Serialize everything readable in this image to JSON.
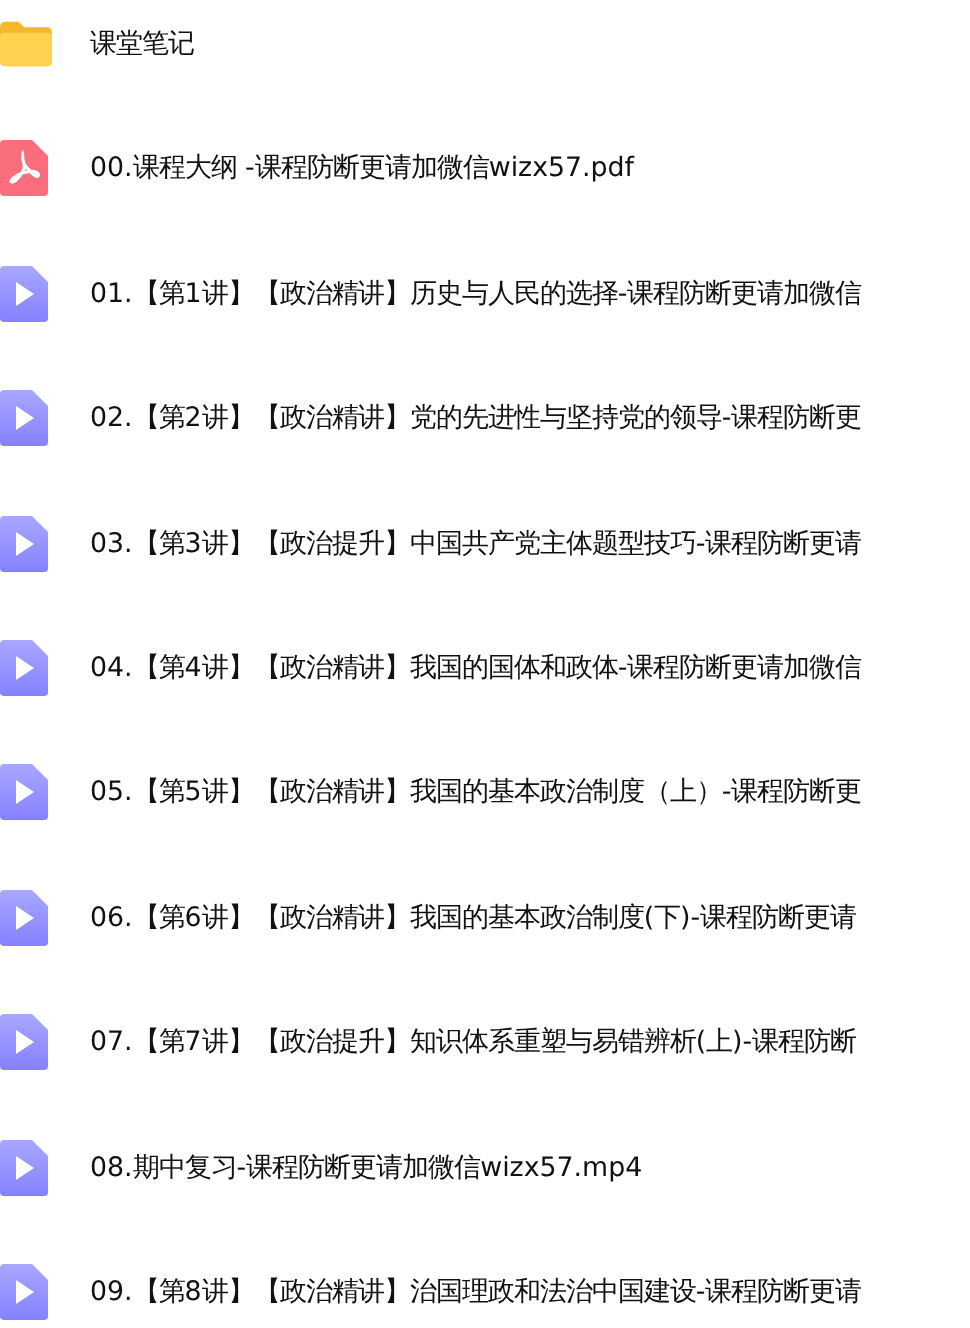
{
  "files": [
    {
      "kind": "folder",
      "name": "课堂笔记"
    },
    {
      "kind": "pdf",
      "name": "00.课程大纲 -课程防断更请加微信wizx57.pdf"
    },
    {
      "kind": "video",
      "name": "01.【第1讲】【政治精讲】历史与人民的选择-课程防断更请加微信"
    },
    {
      "kind": "video",
      "name": "02.【第2讲】【政治精讲】党的先进性与坚持党的领导-课程防断更"
    },
    {
      "kind": "video",
      "name": "03.【第3讲】【政治提升】中国共产党主体题型技巧-课程防断更请"
    },
    {
      "kind": "video",
      "name": "04.【第4讲】【政治精讲】我国的国体和政体-课程防断更请加微信"
    },
    {
      "kind": "video",
      "name": "05.【第5讲】【政治精讲】我国的基本政治制度（上）-课程防断更"
    },
    {
      "kind": "video",
      "name": "06.【第6讲】【政治精讲】我国的基本政治制度(下)-课程防断更请"
    },
    {
      "kind": "video",
      "name": "07.【第7讲】【政治提升】知识体系重塑与易错辨析(上)-课程防断"
    },
    {
      "kind": "video",
      "name": "08.期中复习-课程防断更请加微信wizx57.mp4"
    },
    {
      "kind": "video",
      "name": "09.【第8讲】【政治精讲】治国理政和法治中国建设-课程防断更请"
    }
  ]
}
